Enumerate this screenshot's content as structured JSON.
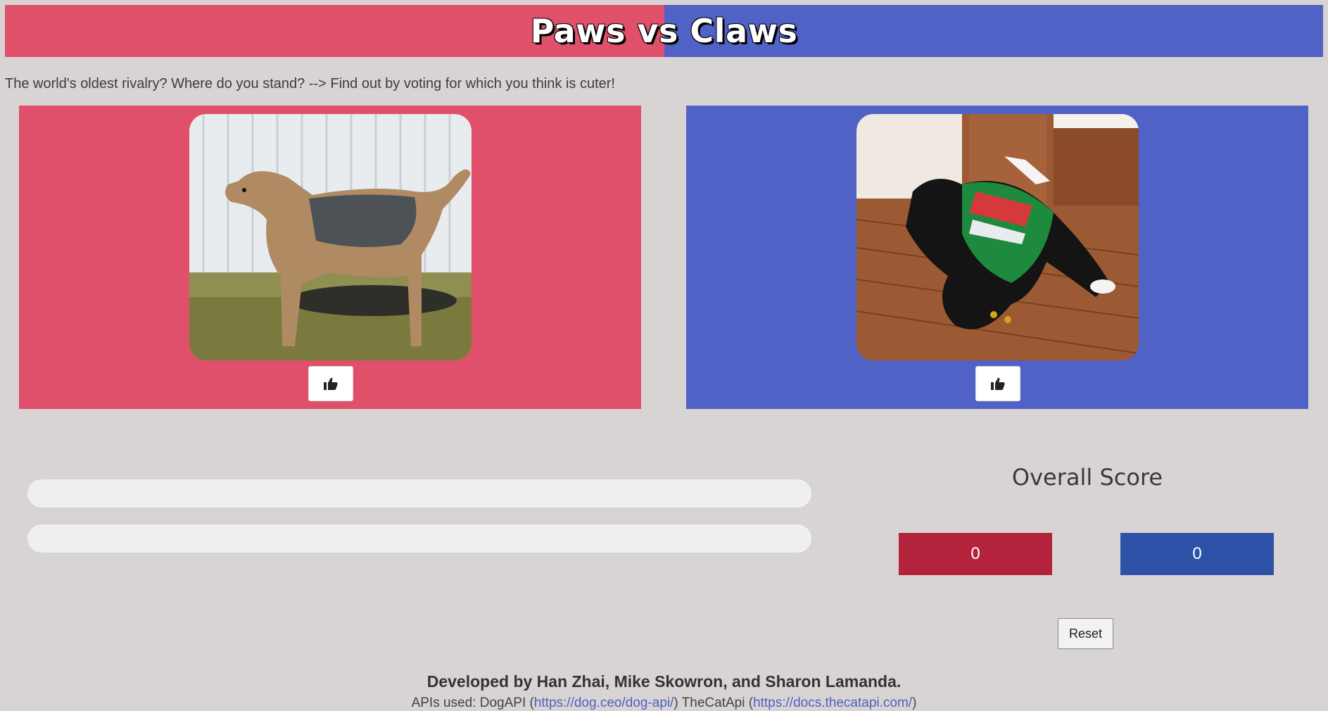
{
  "header": {
    "title": "Paws vs Claws"
  },
  "tagline": "The world's oldest rivalry? Where do you stand? --> Find out by voting for which you think is cuter!",
  "dog_panel": {
    "image_icon": "dog-photo",
    "vote_icon": "thumbs-up-icon"
  },
  "cat_panel": {
    "image_icon": "cat-photo",
    "vote_icon": "thumbs-up-icon"
  },
  "progress": {
    "dog_fraction": 0,
    "cat_fraction": 0
  },
  "score": {
    "title": "Overall Score",
    "dog": "0",
    "cat": "0"
  },
  "reset_label": "Reset",
  "footer": {
    "developed_by": "Developed by Han Zhai, Mike Skowron, and Sharon Lamanda.",
    "apis_prefix": "APIs used: DogAPI (",
    "dog_api_url": "https://dog.ceo/dog-api/",
    "mid": ") TheCatApi (",
    "cat_api_url": "https://docs.thecatapi.com/",
    "suffix": ")"
  },
  "colors": {
    "dog": "#e0506a",
    "cat": "#5062c6",
    "dog_score": "#b3233c",
    "cat_score": "#2f52a9"
  }
}
